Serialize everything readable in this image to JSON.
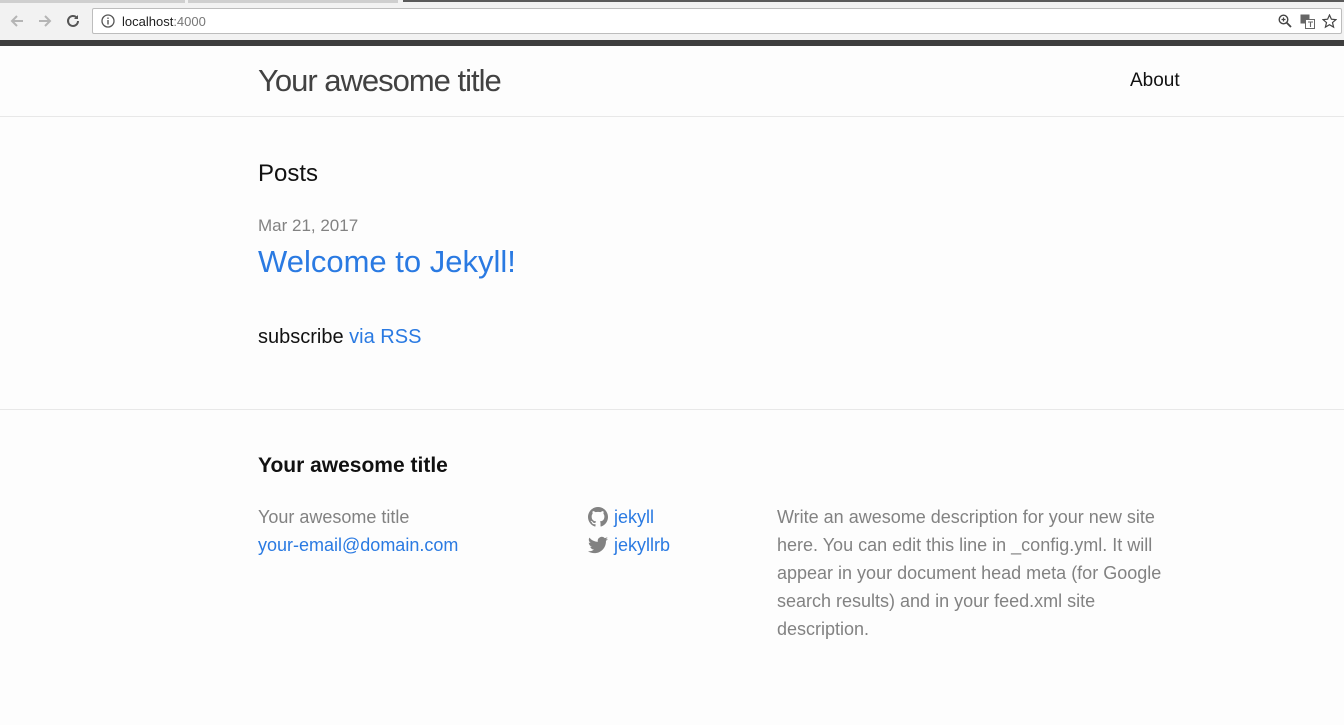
{
  "browser": {
    "url_host": "localhost",
    "url_port": ":4000"
  },
  "header": {
    "site_title": "Your awesome title",
    "nav": [
      "About"
    ]
  },
  "main": {
    "heading": "Posts",
    "posts": [
      {
        "date": "Mar 21, 2017",
        "title": "Welcome to Jekyll!"
      }
    ],
    "subscribe_prefix": "subscribe",
    "subscribe_link": "via RSS"
  },
  "footer": {
    "heading": "Your awesome title",
    "name": "Your awesome title",
    "email": "your-email@domain.com",
    "github": "jekyll",
    "twitter": "jekyllrb",
    "description": "Write an awesome description for your new site here. You can edit this line in _config.yml. It will appear in your document head meta (for Google search results) and in your feed.xml site description."
  },
  "colors": {
    "link": "#2a7ae2",
    "muted": "#828282",
    "text": "#111111"
  }
}
